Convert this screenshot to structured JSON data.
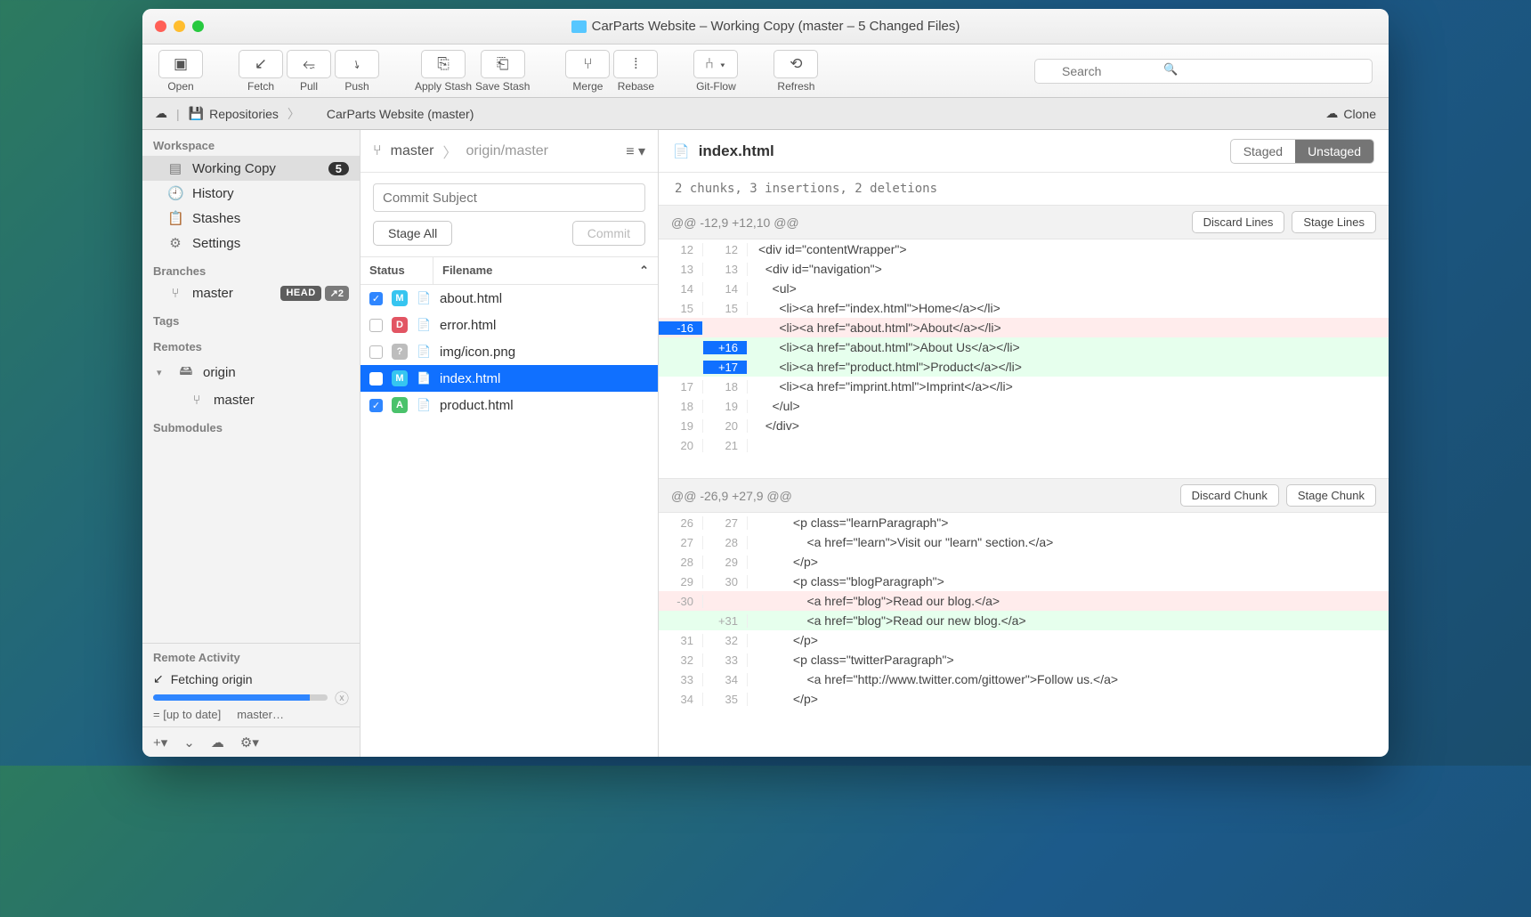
{
  "window": {
    "title": "CarParts Website – Working Copy (master – 5 Changed Files)"
  },
  "toolbar": {
    "open": "Open",
    "fetch": "Fetch",
    "pull": "Pull",
    "push": "Push",
    "apply_stash": "Apply Stash",
    "save_stash": "Save Stash",
    "merge": "Merge",
    "rebase": "Rebase",
    "gitflow": "Git-Flow",
    "refresh": "Refresh",
    "search_placeholder": "Search"
  },
  "pathbar": {
    "repositories": "Repositories",
    "repo": "CarParts Website (master)",
    "clone": "Clone"
  },
  "sidebar": {
    "workspace": "Workspace",
    "working_copy": "Working Copy",
    "working_copy_count": "5",
    "history": "History",
    "stashes": "Stashes",
    "settings": "Settings",
    "branches": "Branches",
    "branch_master": "master",
    "head": "HEAD",
    "ahead": "↗2",
    "tags": "Tags",
    "remotes": "Remotes",
    "origin": "origin",
    "remote_master": "master",
    "submodules": "Submodules",
    "remote_activity": "Remote Activity",
    "fetching": "Fetching origin",
    "status_left": "= [up to date]",
    "status_right": "master…"
  },
  "center": {
    "branch": "master",
    "upstream": "origin/master",
    "commit_placeholder": "Commit Subject",
    "stage_all": "Stage All",
    "commit": "Commit",
    "col_status": "Status",
    "col_filename": "Filename",
    "files": [
      {
        "checked": true,
        "status": "M",
        "name": "about.html"
      },
      {
        "checked": false,
        "status": "D",
        "name": "error.html"
      },
      {
        "checked": false,
        "status": "?",
        "name": "img/icon.png"
      },
      {
        "checked": false,
        "status": "M",
        "name": "index.html",
        "selected": true
      },
      {
        "checked": true,
        "status": "A",
        "name": "product.html"
      }
    ]
  },
  "diff": {
    "filename": "index.html",
    "staged": "Staged",
    "unstaged": "Unstaged",
    "summary": "2 chunks, 3 insertions, 2 deletions",
    "hunk1_header": "@@ -12,9 +12,10 @@",
    "discard_lines": "Discard Lines",
    "stage_lines": "Stage Lines",
    "hunk2_header": "@@ -26,9 +27,9 @@",
    "discard_chunk": "Discard Chunk",
    "stage_chunk": "Stage Chunk",
    "h1": {
      "l1": "<div id=\"contentWrapper\">",
      "l2": "  <div id=\"navigation\">",
      "l3": "    <ul>",
      "l4": "      <li><a href=\"index.html\">Home</a></li>",
      "l5": "      <li><a href=\"about.html\">About</a></li>",
      "l6": "      <li><a href=\"about.html\">About Us</a></li>",
      "l7": "      <li><a href=\"product.html\">Product</a></li>",
      "l8": "      <li><a href=\"imprint.html\">Imprint</a></li>",
      "l9": "    </ul>",
      "l10": "  </div>",
      "l11": ""
    },
    "h2": {
      "l1": "          <p class=\"learnParagraph\">",
      "l2": "              <a href=\"learn\">Visit our \"learn\" section.</a>",
      "l3": "          </p>",
      "l4": "          <p class=\"blogParagraph\">",
      "l5": "              <a href=\"blog\">Read our blog.</a>",
      "l6": "              <a href=\"blog\">Read our new blog.</a>",
      "l7": "          </p>",
      "l8": "          <p class=\"twitterParagraph\">",
      "l9": "              <a href=\"http://www.twitter.com/gittower\">Follow us.</a>",
      "l10": "          </p>"
    },
    "ln": {
      "h1_old": [
        "12",
        "13",
        "14",
        "15",
        "-16",
        "",
        "",
        "17",
        "18",
        "19",
        "20"
      ],
      "h1_new": [
        "12",
        "13",
        "14",
        "15",
        "",
        "+16",
        "+17",
        "18",
        "19",
        "20",
        "21"
      ],
      "h2_old": [
        "26",
        "27",
        "28",
        "29",
        "-30",
        "",
        "31",
        "32",
        "33",
        "34"
      ],
      "h2_new": [
        "27",
        "28",
        "29",
        "30",
        "",
        "+31",
        "32",
        "33",
        "34",
        "35"
      ]
    }
  }
}
